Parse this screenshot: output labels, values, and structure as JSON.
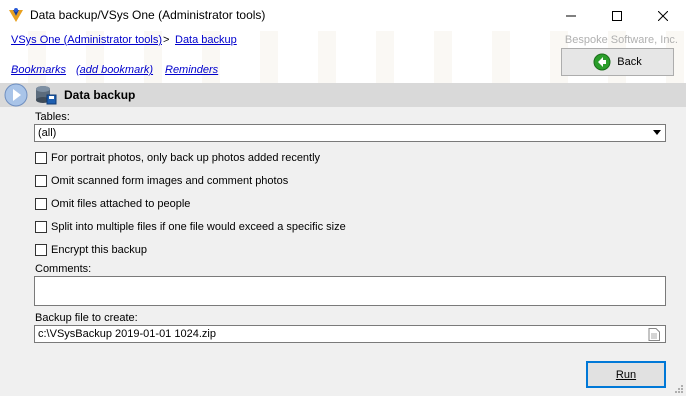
{
  "window": {
    "title": "Data backup/VSys One (Administrator tools)"
  },
  "breadcrumb": {
    "items": [
      "VSys One (Administrator tools)",
      "Data backup"
    ],
    "separator": ">"
  },
  "vendor": "Bespoke Software, Inc.",
  "links": {
    "bookmarks": "Bookmarks",
    "add_bookmark": "(add bookmark)",
    "reminders": "Reminders"
  },
  "back_button": {
    "label": "Back"
  },
  "section": {
    "title": "Data backup"
  },
  "form": {
    "tables_label": "Tables:",
    "tables_value": "(all)",
    "options": [
      {
        "label": "For portrait photos, only back up photos added recently",
        "checked": false
      },
      {
        "label": "Omit scanned form images and comment photos",
        "checked": false
      },
      {
        "label": "Omit files attached to people",
        "checked": false
      },
      {
        "label": "Split into multiple files if one file would exceed a specific size",
        "checked": false
      },
      {
        "label": "Encrypt this backup",
        "checked": false
      }
    ],
    "comments_label": "Comments:",
    "comments_value": "",
    "file_label": "Backup file to create:",
    "file_value": "c:\\VSysBackup 2019-01-01 1024.zip"
  },
  "run_button": {
    "label": "Run"
  },
  "colors": {
    "link": "#0000cc",
    "header_bg": "#d9d9d9",
    "focus_border": "#0078d7",
    "back_icon": "#2a9d2a"
  }
}
